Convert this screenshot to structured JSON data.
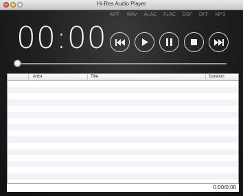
{
  "window": {
    "title": "Hi-Res Audio Player"
  },
  "formats": [
    "AIFF",
    "WAV",
    "ALAC",
    "FLAC",
    "DSF",
    "DFF",
    "MP3"
  ],
  "player": {
    "time": "00:00",
    "progress": 0
  },
  "controls": {
    "prev_icon": "skip-back-icon",
    "play_icon": "play-icon",
    "pause_icon": "pause-icon",
    "stop_icon": "stop-icon",
    "next_icon": "skip-forward-icon"
  },
  "table": {
    "columns": [
      "Artist",
      "Title",
      "Duration"
    ],
    "rows": []
  },
  "footer": {
    "total_time": "0:00/0:00"
  },
  "colors": {
    "accent": "#ffffff",
    "row_stripe": "#f0f3f8"
  }
}
